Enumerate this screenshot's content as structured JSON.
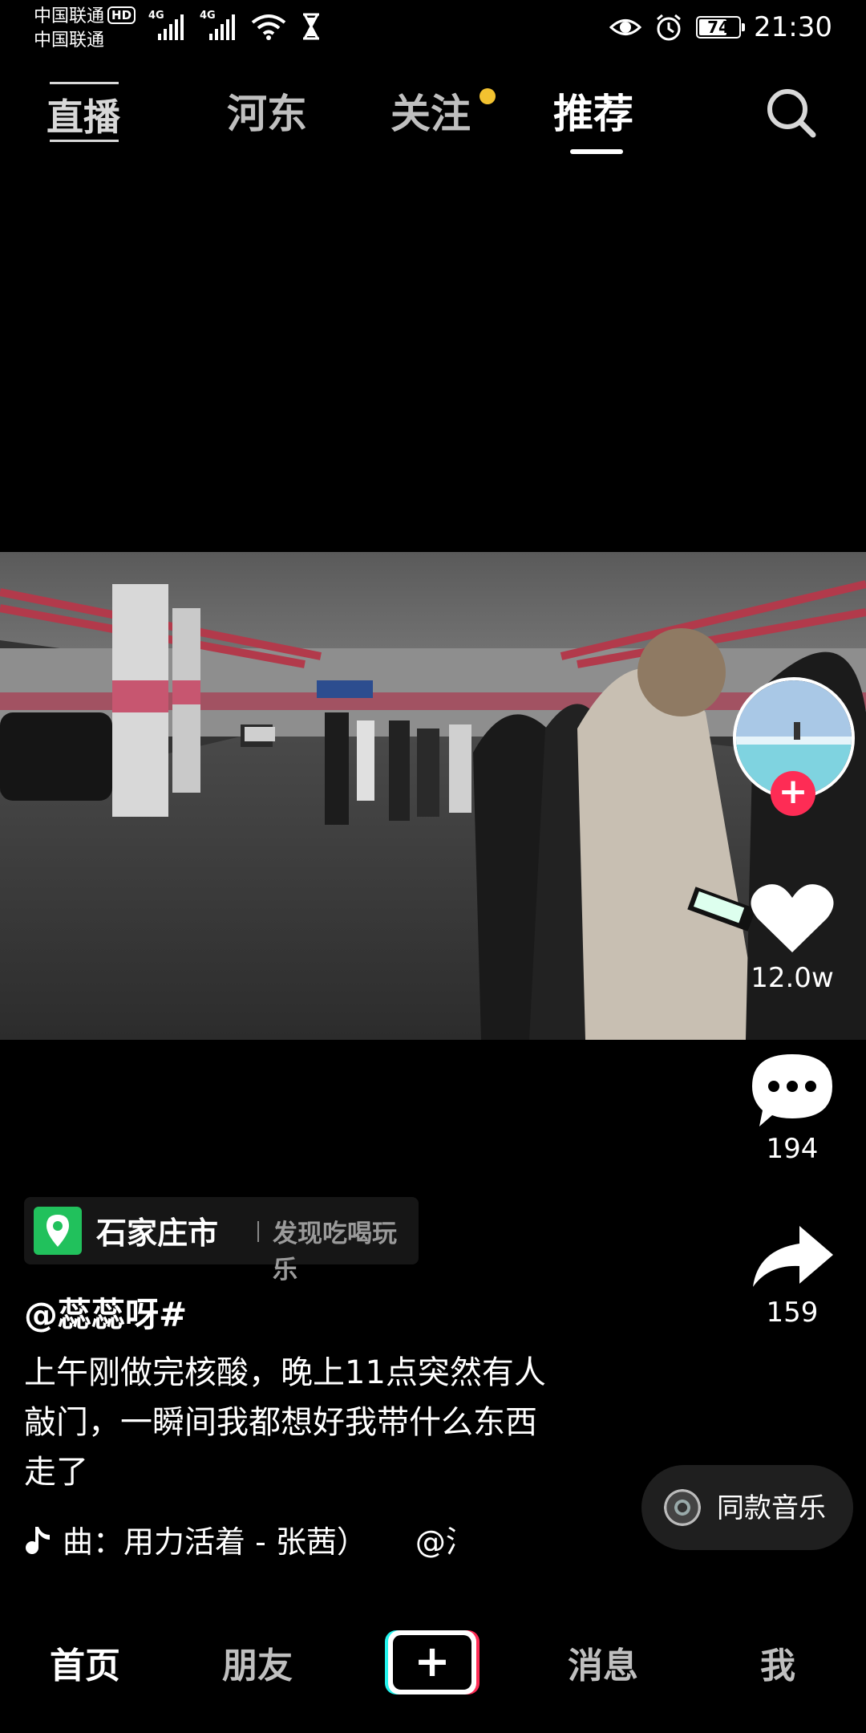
{
  "status_bar": {
    "carrier_1": "中国联通",
    "carrier_2": "中国联通",
    "hd_badge": "HD",
    "network_1": "4G",
    "network_2": "4G",
    "battery_level": 74,
    "battery_text": "74",
    "time": "21:30"
  },
  "top_nav": {
    "live_label": "直播",
    "tabs": [
      {
        "label": "河东"
      },
      {
        "label": "关注"
      },
      {
        "label": "推荐"
      }
    ],
    "active_tab": "推荐"
  },
  "rail": {
    "likes": "12.0w",
    "comments": "194",
    "shares": "159"
  },
  "location": {
    "city": "石家庄市",
    "tag": "发现吃喝玩乐"
  },
  "post": {
    "author": "@蕊蕊呀#",
    "caption_lines": [
      "上午刚做完核酸，晚上11点突然有人",
      "敲门，一瞬间我都想好我带什么东西",
      "走了"
    ],
    "music_text": "曲：用力活着 - 张茜）",
    "music_tail": "@涓"
  },
  "same_music": {
    "label": "同款音乐"
  },
  "bottom_nav": {
    "items": [
      {
        "label": "首页"
      },
      {
        "label": "朋友"
      },
      {
        "label": "消息"
      },
      {
        "label": "我"
      }
    ]
  },
  "colors": {
    "accent_red": "#fe2c55",
    "follow_dot": "#f2c230",
    "location_green": "#21c15c",
    "plus_cyan": "#25f4ee"
  }
}
